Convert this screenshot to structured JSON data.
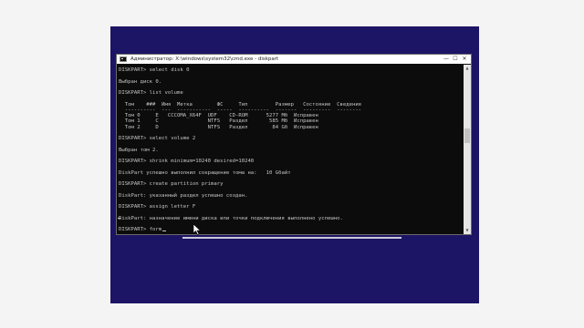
{
  "window": {
    "title": "Администратор: X:\\windows\\system32\\cmd.exe - diskpart",
    "minimize_glyph": "—",
    "maximize_glyph": "☐",
    "close_glyph": "✕"
  },
  "console": {
    "lines": [
      "DISKPART> select disk 0",
      "",
      "Выбран диск 0.",
      "",
      "DISKPART> list volume",
      "",
      "  Том    ###  Имя  Метка        ФС     Тип         Размер   Состояние  Сведения",
      "  ----------  ---  -----------  -----  ----------  -------  ---------  --------",
      "  Том 0     E   CCCOMA_X64F  UDF    CD-ROM      5277 Мб  Исправен",
      "  Том 1     C                NTFS   Раздел       585 Мб  Исправен",
      "  Том 2     D                NTFS   Раздел        84 Gб  Исправен",
      "",
      "DISKPART> select volume 2",
      "",
      "Выбран том 2.",
      "",
      "DISKPART> shrink minimum=10240 desired=10240",
      "",
      "DiskPart успешно выполнил сокращение тома на:   10 Gбайт",
      "",
      "DISKPART> create partition primary",
      "",
      "DiskPart: указанный раздел успешно создан.",
      "",
      "DISKPART> assign letter F",
      "",
      "DiskPart: назначение имени диска или точки подключения выполнено успешно.",
      "",
      "DISKPART> form"
    ]
  },
  "icons": {
    "window_icon": "cmd-icon",
    "mouse_pointer": "mouse-pointer-icon"
  },
  "colors": {
    "desktop": "#1c1464",
    "console_bg": "#0c0c0c",
    "console_text": "#c4c4c4",
    "page_bg": "#f4f4f4"
  }
}
